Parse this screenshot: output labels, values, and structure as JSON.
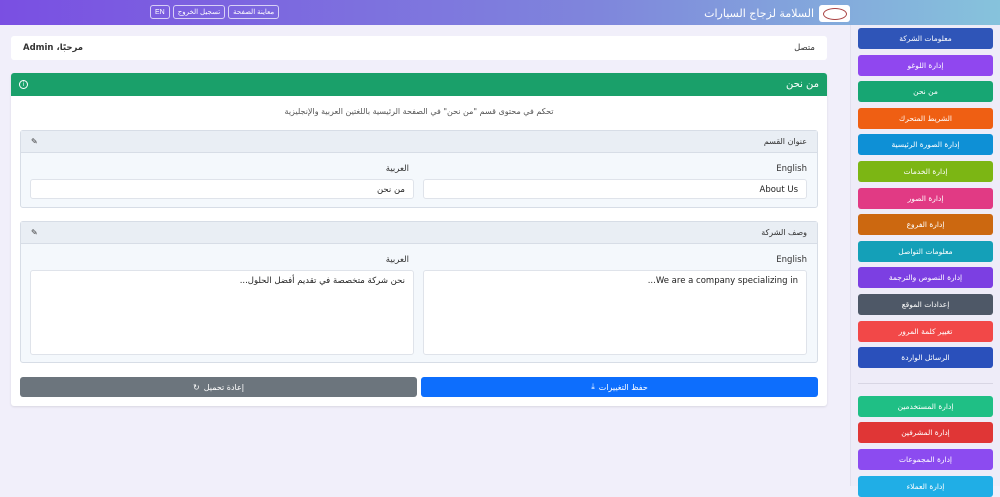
{
  "header": {
    "site_title": "السلامة لزجاج السيارات",
    "preview": "معاينة الصفحة",
    "logout": "تسجيل الخروج",
    "lang": "EN"
  },
  "welcome": {
    "status": "متصل",
    "greeting": "مرحبًا، Admin"
  },
  "card": {
    "title": "من نحن",
    "description": "تحكم في محتوى قسم \"من نحن\" في الصفحة الرئيسية باللغتين العربية والإنجليزية",
    "section_title": {
      "heading": "عنوان القسم",
      "english_label": "English",
      "arabic_label": "العربية",
      "english_value": "About Us",
      "arabic_value": "من نحن"
    },
    "company_desc": {
      "heading": "وصف الشركة",
      "english_label": "English",
      "arabic_label": "العربية",
      "english_value": "We are a company specializing in...",
      "arabic_value": "نحن شركة متخصصة في تقديم أفضل الحلول..."
    },
    "save": "حفظ التغييرات",
    "reload": "إعادة تحميل"
  },
  "sidebar": {
    "items": [
      {
        "label": "معلومات الشركة",
        "color": "#2f55b8"
      },
      {
        "label": "إدارة اللوغو",
        "color": "#9047ef"
      },
      {
        "label": "من نحن",
        "color": "#17a673"
      },
      {
        "label": "الشريط المتحرك",
        "color": "#ef5f13"
      },
      {
        "label": "إدارة الصورة الرئيسية",
        "color": "#0e90d6"
      },
      {
        "label": "إدارة الخدمات",
        "color": "#7cb614"
      },
      {
        "label": "إدارة الصور",
        "color": "#e13a84"
      },
      {
        "label": "إدارة الفروع",
        "color": "#cc6810"
      },
      {
        "label": "معلومات التواصل",
        "color": "#14a0b8"
      },
      {
        "label": "إدارة النصوص والترجمة",
        "color": "#7c3fe2"
      },
      {
        "label": "إعدادات الموقع",
        "color": "#4e5867"
      },
      {
        "label": "تغيير كلمة المرور",
        "color": "#f24848"
      },
      {
        "label": "الرسائل الواردة",
        "color": "#2a50bb"
      },
      {
        "label": "إدارة المستخدمين",
        "color": "#1fbf85"
      },
      {
        "label": "إدارة المشرفين",
        "color": "#e03636"
      },
      {
        "label": "إدارة المجموعات",
        "color": "#8c4bf0"
      },
      {
        "label": "إدارة العملاء",
        "color": "#20aee6"
      }
    ]
  }
}
